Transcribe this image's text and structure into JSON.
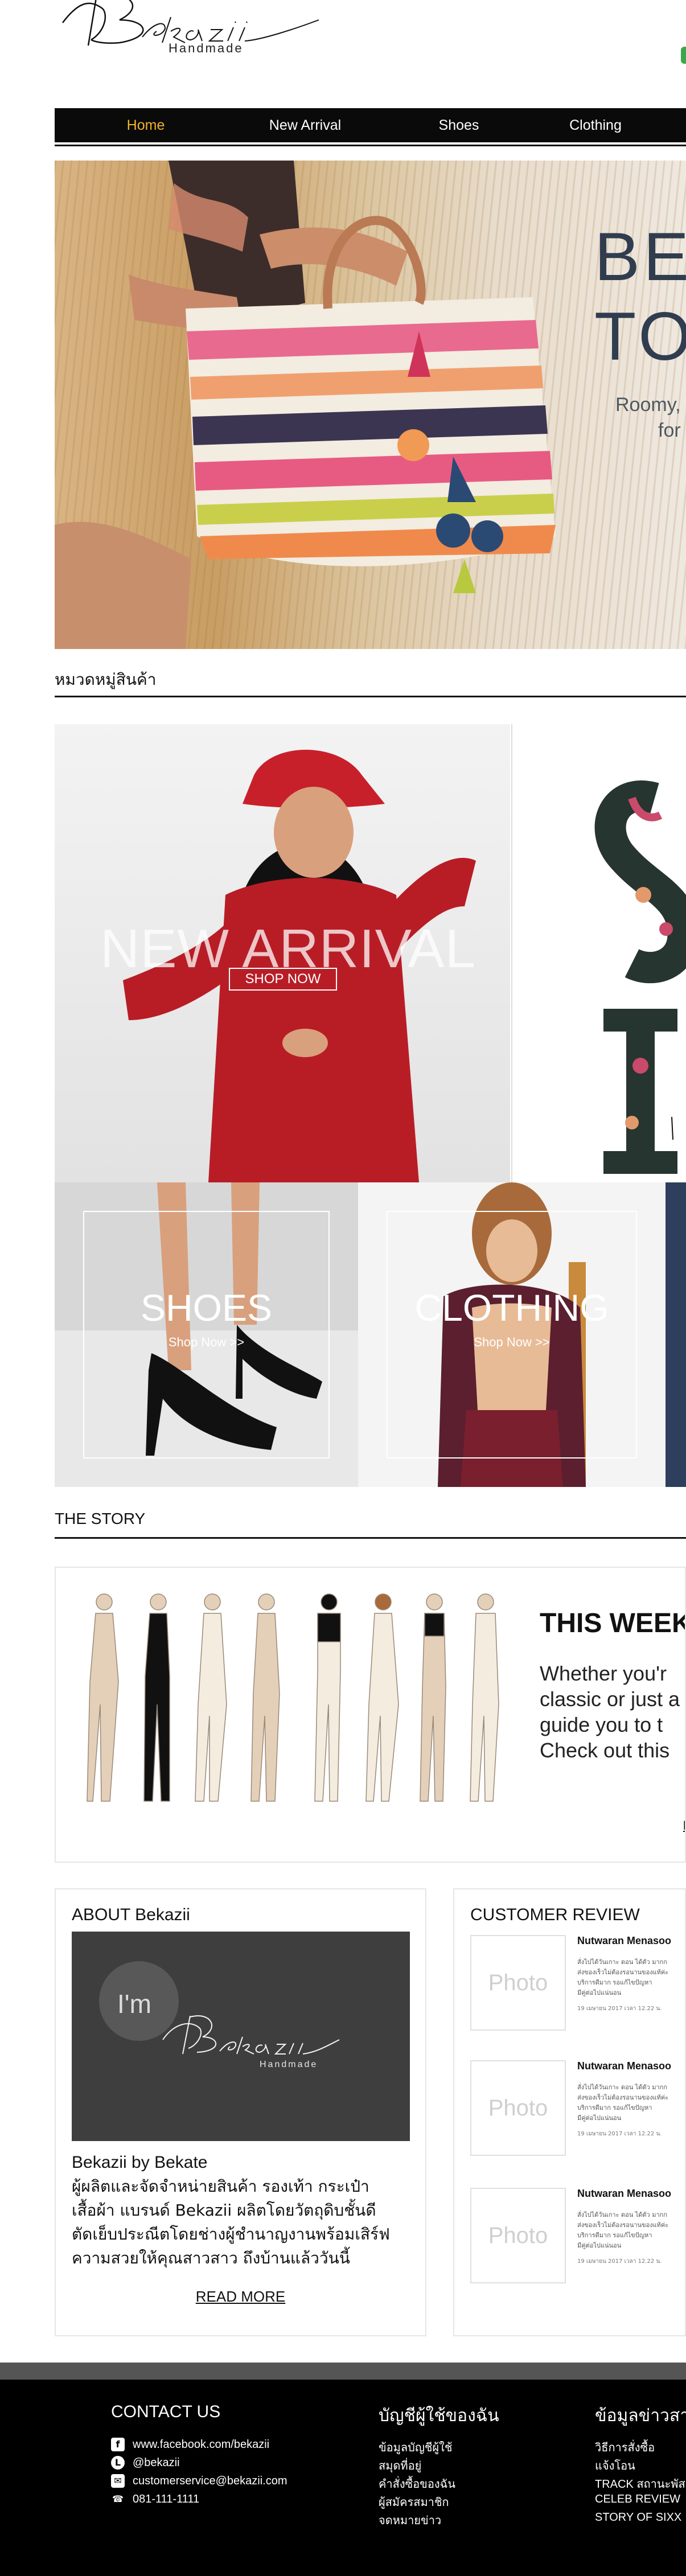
{
  "header": {
    "logo_script": "Bekazii",
    "logo_sub": "Handmade"
  },
  "nav": {
    "items": [
      {
        "label": "Home",
        "active": true
      },
      {
        "label": "New Arrival",
        "active": false
      },
      {
        "label": "Shoes",
        "active": false
      },
      {
        "label": "Clothing",
        "active": false
      }
    ]
  },
  "hero": {
    "title_line1": "BE",
    "title_line2": "TO",
    "sub_line1": "Roomy,",
    "sub_line2": "for"
  },
  "categories": {
    "section_title": "หมวดหมู่สินค้า",
    "new_arrival": {
      "label": "NEW ARRIVAL",
      "button": "SHOP NOW"
    },
    "shoes": {
      "label": "SHOES",
      "shop": "Shop Now >>"
    },
    "clothing": {
      "label": "CLOTHING",
      "shop": "Shop Now >>"
    }
  },
  "story": {
    "section_title": "THE STORY",
    "heading": "THIS WEEK",
    "lines": [
      "Whether you'r",
      "classic or just a",
      "guide you to t",
      "Check out this"
    ],
    "link": "R"
  },
  "about": {
    "title": "ABOUT Bekazii",
    "image_text": "I'm",
    "image_logo": "Bekazii",
    "image_sub": "Handmade",
    "byline": "Bekazii by Bekate",
    "desc_lines": [
      "ผู้ผลิตและจัดจำหน่ายสินค้า รองเท้า กระเป๋า",
      "เสื้อผ้า แบรนด์ Bekazii ผลิตโดยวัตถุดิบชั้นดี",
      "ตัดเย็บประณีตโดยช่างผู้ชำนาญงานพร้อมเสิร์ฟ",
      "ความสวยให้คุณสาวสาว ถึงบ้านแล้ววันนี้"
    ],
    "read_more": "READ MORE"
  },
  "reviews": {
    "title": "CUSTOMER REVIEW",
    "items": [
      {
        "photo": "Photo",
        "name": "Nutwaran Menasoo",
        "lines": [
          "สั่งไปได้วันเกาะ ดอน ได้ตัว มากก",
          "ส่งของเร็วไม่ต้องรอนานของแท้ค่ะ",
          "บริการดีมาก รอแก้ไขปัญหา",
          "มีคู่ต่อไปแน่นอน"
        ],
        "date": "19 เมษายน 2017 เวลา 12.22 น."
      },
      {
        "photo": "Photo",
        "name": "Nutwaran Menasoo",
        "lines": [
          "สั่งไปได้วันเกาะ ดอน ได้ตัว มากก",
          "ส่งของเร็วไม่ต้องรอนานของแท้ค่ะ",
          "บริการดีมาก รอแก้ไขปัญหา",
          "มีคู่ต่อไปแน่นอน"
        ],
        "date": "19 เมษายน 2017 เวลา 12.22 น."
      },
      {
        "photo": "Photo",
        "name": "Nutwaran Menasoo",
        "lines": [
          "สั่งไปได้วันเกาะ ดอน ได้ตัว มากก",
          "ส่งของเร็วไม่ต้องรอนานของแท้ค่ะ",
          "บริการดีมาก รอแก้ไขปัญหา",
          "มีคู่ต่อไปแน่นอน"
        ],
        "date": "19 เมษายน 2017 เวลา 12.22 น."
      }
    ]
  },
  "footer": {
    "contact": {
      "title": "CONTACT US",
      "items": [
        {
          "icon": "facebook-icon",
          "glyph": "f",
          "text": "www.facebook.com/bekazii"
        },
        {
          "icon": "line-icon",
          "glyph": "L",
          "text": "@bekazii"
        },
        {
          "icon": "mail-icon",
          "glyph": "✉",
          "text": "customerservice@bekazii.com"
        },
        {
          "icon": "phone-icon",
          "glyph": "☎",
          "text": "081-111-1111"
        }
      ]
    },
    "account": {
      "title": "บัญชีผู้ใช้ของฉัน",
      "items": [
        "ข้อมูลบัญชีผู้ใช้",
        "สมุดที่อยู่",
        "คำสั่งซื้อของฉัน",
        "ผู้สมัครสมาชิก",
        "จดหมายข่าว"
      ]
    },
    "info": {
      "title": "ข้อมูลข่าวสาร",
      "items": [
        "วิธีการสั่งซื้อ",
        "แจ้งโอน",
        "TRACK สถานะพัสดุ",
        "CELEB REVIEW",
        "STORY OF SIXX"
      ]
    }
  }
}
